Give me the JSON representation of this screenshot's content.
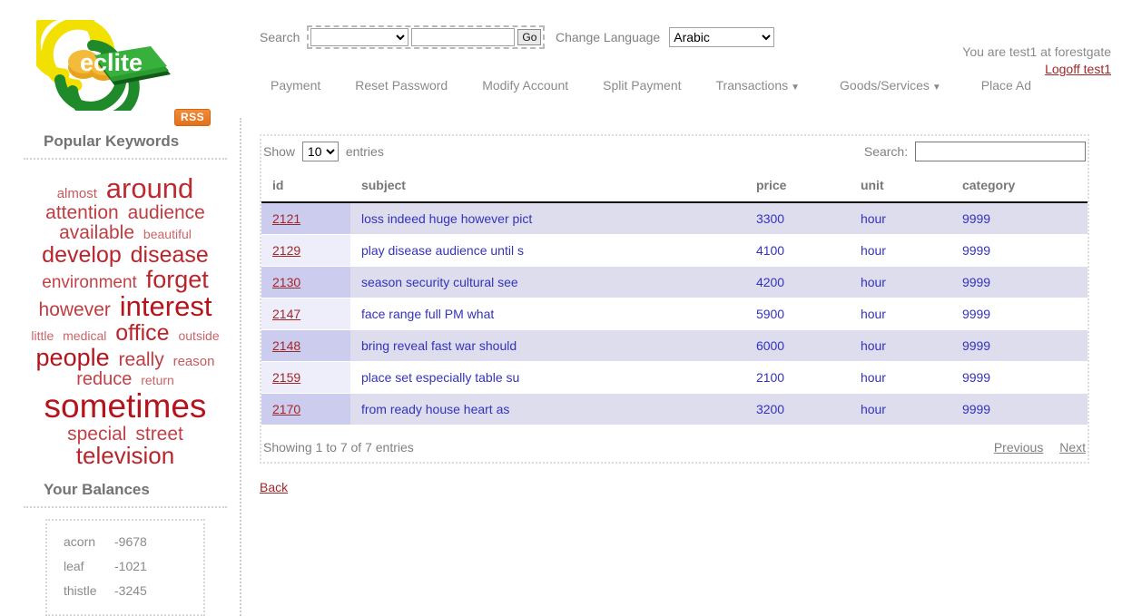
{
  "header": {
    "logo_text": "eclite",
    "rss_label": "RSS",
    "search_label": "Search",
    "search_category_selected": "",
    "search_input_value": "",
    "search_input_placeholder": "",
    "go_label": "Go",
    "change_language_label": "Change Language",
    "language_selected": "Arabic",
    "user_status": "You are test1 at forestgate",
    "logoff_label": "Logoff test1"
  },
  "nav": {
    "items": [
      {
        "label": "Payment",
        "caret": ""
      },
      {
        "label": "Reset Password",
        "caret": ""
      },
      {
        "label": "Modify Account",
        "caret": ""
      },
      {
        "label": "Split Payment",
        "caret": ""
      },
      {
        "label": "Transactions",
        "caret": "▼"
      },
      {
        "label": "Goods/Services",
        "caret": "▼"
      },
      {
        "label": "Place Ad",
        "caret": ""
      }
    ]
  },
  "sidebar": {
    "keywords_title": "Popular Keywords",
    "keywords": [
      {
        "text": "almost",
        "size": 15,
        "color": "#c9585c"
      },
      {
        "text": "around",
        "size": 31,
        "color": "#bc2b32"
      },
      {
        "text": "attention",
        "size": 21,
        "color": "#bf3c41"
      },
      {
        "text": "audience",
        "size": 21,
        "color": "#bf3c41"
      },
      {
        "text": "available",
        "size": 21,
        "color": "#bf3c41"
      },
      {
        "text": "beautiful",
        "size": 14,
        "color": "#cb6468"
      },
      {
        "text": "develop",
        "size": 25,
        "color": "#b9252c"
      },
      {
        "text": "disease",
        "size": 25,
        "color": "#b9252c"
      },
      {
        "text": "environment",
        "size": 19,
        "color": "#c34146"
      },
      {
        "text": "forget",
        "size": 27,
        "color": "#b9252c"
      },
      {
        "text": "however",
        "size": 21,
        "color": "#bf3c41"
      },
      {
        "text": "interest",
        "size": 31,
        "color": "#b5141c"
      },
      {
        "text": "little",
        "size": 14,
        "color": "#cb6468"
      },
      {
        "text": "medical",
        "size": 14,
        "color": "#cb6468"
      },
      {
        "text": "office",
        "size": 25,
        "color": "#b9252c"
      },
      {
        "text": "outside",
        "size": 14,
        "color": "#cb6468"
      },
      {
        "text": "people",
        "size": 27,
        "color": "#b5141c"
      },
      {
        "text": "really",
        "size": 21,
        "color": "#bf3c41"
      },
      {
        "text": "reason",
        "size": 15,
        "color": "#c9585c"
      },
      {
        "text": "reduce",
        "size": 20,
        "color": "#c34146"
      },
      {
        "text": "return",
        "size": 14,
        "color": "#cb6468"
      },
      {
        "text": "sometimes",
        "size": 37,
        "color": "#b5141c"
      },
      {
        "text": "special",
        "size": 21,
        "color": "#c34146"
      },
      {
        "text": "street",
        "size": 21,
        "color": "#c34146"
      },
      {
        "text": "television",
        "size": 26,
        "color": "#b9252c"
      }
    ],
    "balances_title": "Your Balances",
    "balances": [
      {
        "name": "acorn",
        "value": "-9678"
      },
      {
        "name": "leaf",
        "value": "-1021"
      },
      {
        "name": "thistle",
        "value": "-3245"
      }
    ]
  },
  "main": {
    "show_label": "Show",
    "entries_label": "entries",
    "page_length": "10",
    "filter_label": "Search:",
    "filter_value": "",
    "columns": [
      "id",
      "subject",
      "price",
      "unit",
      "category"
    ],
    "rows": [
      {
        "id": "2121",
        "subject": "loss indeed huge however pict",
        "price": "3300",
        "unit": "hour",
        "category": "9999"
      },
      {
        "id": "2129",
        "subject": "play disease audience until s",
        "price": "4100",
        "unit": "hour",
        "category": "9999"
      },
      {
        "id": "2130",
        "subject": "season security cultural see",
        "price": "4200",
        "unit": "hour",
        "category": "9999"
      },
      {
        "id": "2147",
        "subject": "face range full PM what",
        "price": "5900",
        "unit": "hour",
        "category": "9999"
      },
      {
        "id": "2148",
        "subject": "bring reveal fast war should",
        "price": "6000",
        "unit": "hour",
        "category": "9999"
      },
      {
        "id": "2159",
        "subject": "place set especially table su",
        "price": "2100",
        "unit": "hour",
        "category": "9999"
      },
      {
        "id": "2170",
        "subject": "from ready house heart as",
        "price": "3200",
        "unit": "hour",
        "category": "9999"
      }
    ],
    "info": "Showing 1 to 7 of 7 entries",
    "previous_label": "Previous",
    "next_label": "Next",
    "back_label": "Back"
  }
}
